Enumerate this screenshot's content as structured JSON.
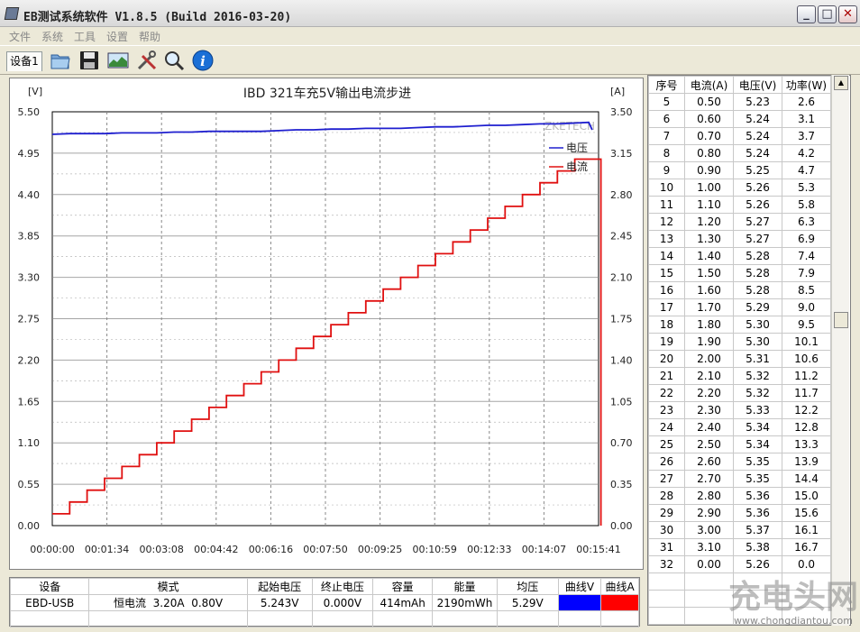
{
  "window": {
    "title": "EB测试系统软件 V1.8.5 (Build 2016-03-20)",
    "min_label": "_",
    "max_label": "□",
    "close_label": "✕"
  },
  "menu": [
    "文件",
    "系统",
    "工具",
    "设置",
    "帮助"
  ],
  "toolbar": {
    "device_tab": "设备1",
    "icons": [
      "open-folder-icon",
      "save-disk-icon",
      "chart-image-icon",
      "tools-icon",
      "magnifier-icon",
      "info-icon"
    ]
  },
  "colors": {
    "voltage": "#1f1fcf",
    "current": "#e01010",
    "grid": "#888888"
  },
  "legend": {
    "voltage": "电压",
    "current": "电流"
  },
  "chart_data": {
    "type": "line",
    "title": "IBD 321车充5V输出电流步进",
    "watermark": "ZKETECH",
    "left_unit": "[V]",
    "right_unit": "[A]",
    "y_left_ticks": [
      "5.50",
      "4.95",
      "4.40",
      "3.85",
      "3.30",
      "2.75",
      "2.20",
      "1.65",
      "1.10",
      "0.55",
      "0.00"
    ],
    "y_right_ticks": [
      "3.50",
      "3.15",
      "2.80",
      "2.45",
      "2.10",
      "1.75",
      "1.40",
      "1.05",
      "0.70",
      "0.35",
      "0.00"
    ],
    "x_ticks": [
      "00:00:00",
      "00:01:34",
      "00:03:08",
      "00:04:42",
      "00:06:16",
      "00:07:50",
      "00:09:25",
      "00:10:59",
      "00:12:33",
      "00:14:07",
      "00:15:41"
    ],
    "ylim_left": [
      0,
      5.5
    ],
    "ylim_right": [
      0,
      3.5
    ],
    "xlim_seconds": [
      0,
      941
    ],
    "grid": true,
    "legend_position": "top-right",
    "series": [
      {
        "name": "电压",
        "axis": "left",
        "x_seconds": [
          0,
          30,
          60,
          90,
          120,
          150,
          180,
          210,
          240,
          270,
          300,
          330,
          360,
          390,
          420,
          450,
          480,
          510,
          540,
          570,
          600,
          630,
          660,
          690,
          720,
          750,
          780,
          810,
          840,
          870,
          900,
          924,
          930
        ],
        "values": [
          5.2,
          5.21,
          5.21,
          5.21,
          5.22,
          5.22,
          5.22,
          5.23,
          5.23,
          5.24,
          5.24,
          5.24,
          5.24,
          5.25,
          5.26,
          5.26,
          5.27,
          5.27,
          5.28,
          5.28,
          5.28,
          5.29,
          5.3,
          5.3,
          5.31,
          5.32,
          5.32,
          5.33,
          5.34,
          5.34,
          5.35,
          5.36,
          5.26
        ]
      },
      {
        "name": "电流",
        "axis": "right",
        "step_seconds": 30,
        "values": [
          0.1,
          0.2,
          0.3,
          0.4,
          0.5,
          0.6,
          0.7,
          0.8,
          0.9,
          1.0,
          1.1,
          1.2,
          1.3,
          1.4,
          1.5,
          1.6,
          1.7,
          1.8,
          1.9,
          2.0,
          2.1,
          2.2,
          2.3,
          2.4,
          2.5,
          2.6,
          2.7,
          2.8,
          2.9,
          3.0,
          3.1
        ],
        "drop_at_seconds": 945
      }
    ]
  },
  "table": {
    "headers": [
      "序号",
      "电流(A)",
      "电压(V)",
      "功率(W)"
    ],
    "rows": [
      [
        "5",
        "0.50",
        "5.23",
        "2.6"
      ],
      [
        "6",
        "0.60",
        "5.24",
        "3.1"
      ],
      [
        "7",
        "0.70",
        "5.24",
        "3.7"
      ],
      [
        "8",
        "0.80",
        "5.24",
        "4.2"
      ],
      [
        "9",
        "0.90",
        "5.25",
        "4.7"
      ],
      [
        "10",
        "1.00",
        "5.26",
        "5.3"
      ],
      [
        "11",
        "1.10",
        "5.26",
        "5.8"
      ],
      [
        "12",
        "1.20",
        "5.27",
        "6.3"
      ],
      [
        "13",
        "1.30",
        "5.27",
        "6.9"
      ],
      [
        "14",
        "1.40",
        "5.28",
        "7.4"
      ],
      [
        "15",
        "1.50",
        "5.28",
        "7.9"
      ],
      [
        "16",
        "1.60",
        "5.28",
        "8.5"
      ],
      [
        "17",
        "1.70",
        "5.29",
        "9.0"
      ],
      [
        "18",
        "1.80",
        "5.30",
        "9.5"
      ],
      [
        "19",
        "1.90",
        "5.30",
        "10.1"
      ],
      [
        "20",
        "2.00",
        "5.31",
        "10.6"
      ],
      [
        "21",
        "2.10",
        "5.32",
        "11.2"
      ],
      [
        "22",
        "2.20",
        "5.32",
        "11.7"
      ],
      [
        "23",
        "2.30",
        "5.33",
        "12.2"
      ],
      [
        "24",
        "2.40",
        "5.34",
        "12.8"
      ],
      [
        "25",
        "2.50",
        "5.34",
        "13.3"
      ],
      [
        "26",
        "2.60",
        "5.35",
        "13.9"
      ],
      [
        "27",
        "2.70",
        "5.35",
        "14.4"
      ],
      [
        "28",
        "2.80",
        "5.36",
        "15.0"
      ],
      [
        "29",
        "2.90",
        "5.36",
        "15.6"
      ],
      [
        "30",
        "3.00",
        "5.37",
        "16.1"
      ],
      [
        "31",
        "3.10",
        "5.38",
        "16.7"
      ],
      [
        "32",
        "0.00",
        "5.26",
        "0.0"
      ]
    ],
    "empty_rows": 3
  },
  "summary": {
    "headers": [
      "设备",
      "模式",
      "起始电压",
      "终止电压",
      "容量",
      "能量",
      "均压",
      "曲线V",
      "曲线A"
    ],
    "row": [
      "EBD-USB",
      "恒电流  3.20A  0.80V",
      "5.243V",
      "0.000V",
      "414mAh",
      "2190mWh",
      "5.29V"
    ],
    "swatch_colors": [
      "#0000ff",
      "#ff0000"
    ]
  },
  "watermark": {
    "brand": "充电头网",
    "url": "www.chongdiantou.com"
  }
}
